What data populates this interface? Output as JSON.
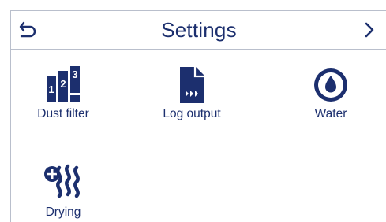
{
  "header": {
    "title": "Settings",
    "back_icon": "back-arrow-icon",
    "next_icon": "chevron-right-icon"
  },
  "tiles": [
    {
      "label": "Dust filter",
      "icon": "dust-filter-icon",
      "icon_text": [
        "1",
        "2",
        "3"
      ]
    },
    {
      "label": "Log output",
      "icon": "log-output-icon"
    },
    {
      "label": "Water",
      "icon": "water-drop-icon"
    },
    {
      "label": "Drying",
      "icon": "drying-icon"
    }
  ],
  "colors": {
    "accent": "#1c2f6e",
    "border": "#b9bfcc",
    "background": "#ffffff"
  }
}
